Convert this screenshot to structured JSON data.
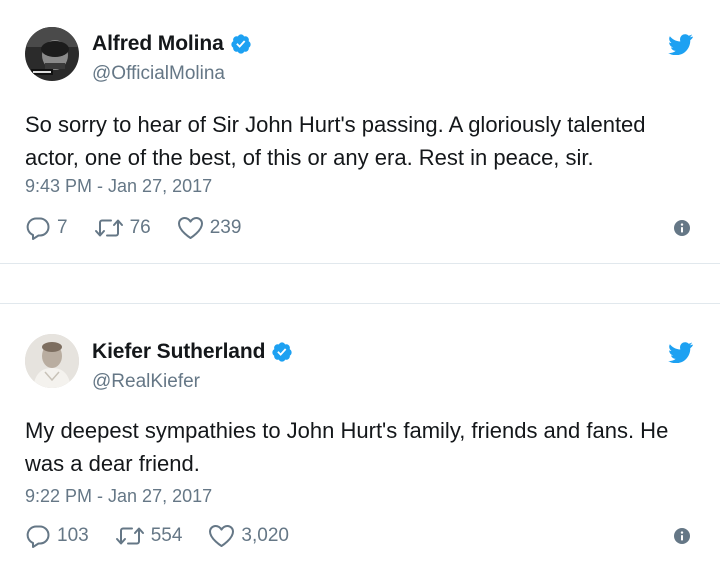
{
  "colors": {
    "text": "#14171a",
    "secondary": "#657786",
    "twitter_blue": "#1da1f2",
    "divider": "#e1e8ed"
  },
  "tweets": [
    {
      "display_name": "Alfred Molina",
      "handle": "@OfficialMolina",
      "verified": true,
      "text": "So sorry to hear of Sir John Hurt's passing. A gloriously talented actor, one of the best, of this or any era. Rest in peace, sir.",
      "timestamp": "9:43 PM - Jan 27, 2017",
      "replies": "7",
      "retweets": "76",
      "likes": "239"
    },
    {
      "display_name": "Kiefer Sutherland",
      "handle": "@RealKiefer",
      "verified": true,
      "text": "My deepest sympathies to John Hurt's family, friends and fans. He was a dear friend.",
      "timestamp": "9:22 PM - Jan 27, 2017",
      "replies": "103",
      "retweets": "554",
      "likes": "3,020"
    }
  ],
  "icons": {
    "reply": "reply-icon",
    "retweet": "retweet-icon",
    "like": "heart-icon",
    "info": "info-icon",
    "brand": "twitter-bird-icon",
    "verified": "verified-badge-icon"
  }
}
